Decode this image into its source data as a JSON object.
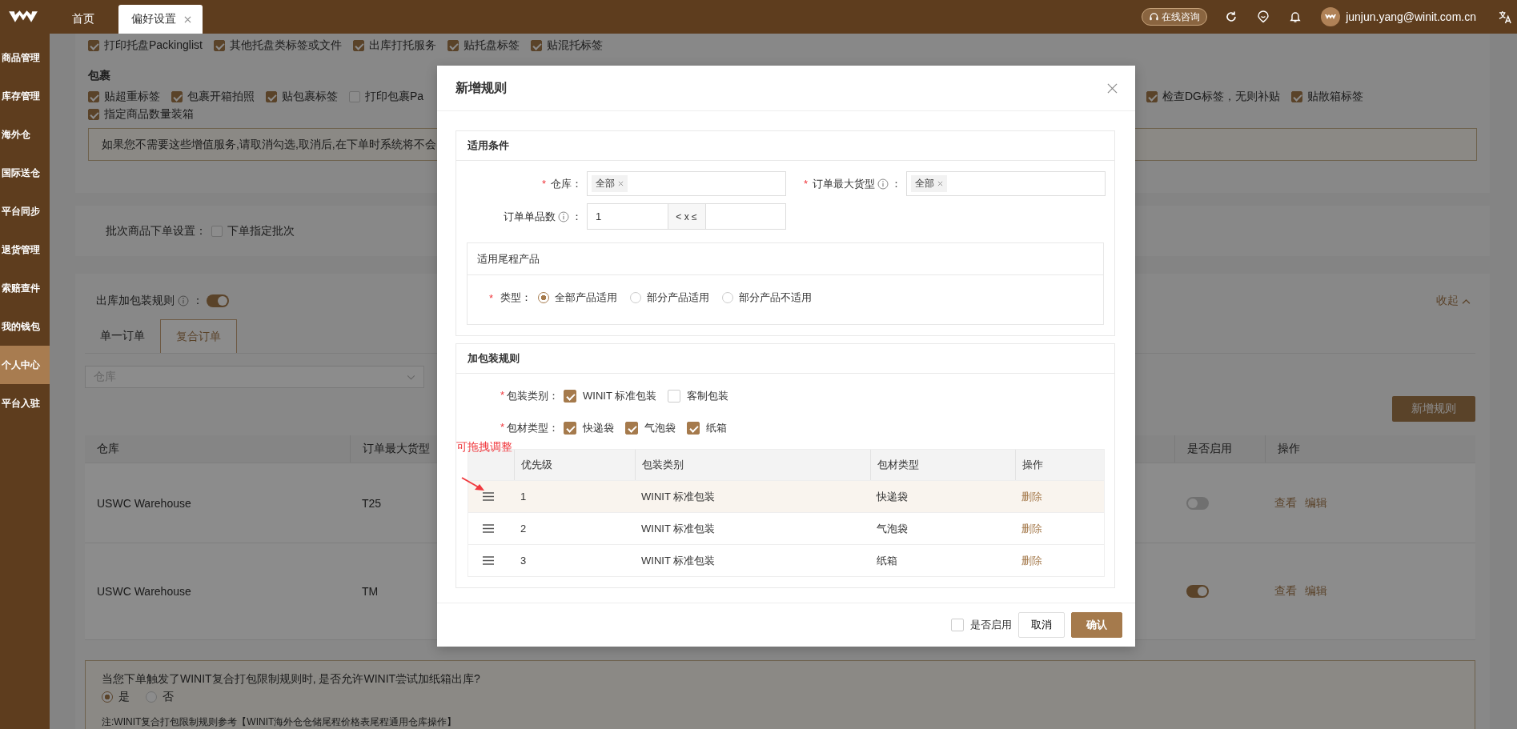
{
  "top_bar": {
    "tabs": [
      {
        "label": "首页",
        "selected": false
      },
      {
        "label": "偏好设置",
        "selected": true
      }
    ],
    "consult_button": "在线咨询",
    "user_email": "junjun.yang@winit.com.cn"
  },
  "sidebar": {
    "items": [
      {
        "label": "商品管理",
        "selected": false
      },
      {
        "label": "库存管理",
        "selected": false
      },
      {
        "label": "海外仓",
        "selected": false
      },
      {
        "label": "国际送仓",
        "selected": false
      },
      {
        "label": "平台同步",
        "selected": false
      },
      {
        "label": "退货管理",
        "selected": false
      },
      {
        "label": "索赔查件",
        "selected": false
      },
      {
        "label": "我的钱包",
        "selected": false
      },
      {
        "label": "个人中心",
        "selected": true
      },
      {
        "label": "平台入驻",
        "selected": false
      }
    ]
  },
  "pallet_services": [
    {
      "label": "打印托盘Packinglist",
      "checked": true
    },
    {
      "label": "其他托盘类标签或文件",
      "checked": true
    },
    {
      "label": "出库打托服务",
      "checked": true
    },
    {
      "label": "贴托盘标签",
      "checked": true
    },
    {
      "label": "贴混托标签",
      "checked": true
    }
  ],
  "parcel": {
    "title": "包裹",
    "services_line_1": [
      {
        "label": "贴超重标签",
        "checked": true
      },
      {
        "label": "包裹开箱拍照",
        "checked": true
      },
      {
        "label": "贴包裹标签",
        "checked": true
      },
      {
        "label": "打印包裹Pa",
        "checked": false
      }
    ],
    "services_line_2": [
      {
        "label": "指定商品数量装箱",
        "checked": true
      }
    ],
    "services_right": [
      {
        "label": "检查DG标签，无则补贴",
        "checked": true
      },
      {
        "label": "贴散箱标签",
        "checked": true
      }
    ]
  },
  "notice": "如果您不需要这些增值服务,请取消勾选,取消后,在下单时系统将不会",
  "batch_setting": {
    "label": "批次商品下单设置：",
    "option": {
      "label": "下单指定批次",
      "checked": false
    }
  },
  "packing_rules": {
    "label": "出库加包装规则",
    "suffix": "：",
    "on": true,
    "collapse": "收起",
    "tabs": [
      {
        "label": "单一订单",
        "selected": false
      },
      {
        "label": "复合订单",
        "selected": true
      }
    ],
    "warehouse_filter": {
      "placeholder": "仓库"
    },
    "add_button": "新增规则",
    "table": {
      "columns": [
        "仓库",
        "订单最大货型",
        "是否启用",
        "操作"
      ],
      "rows": [
        {
          "warehouse": "USWC Warehouse",
          "max_size": "T25",
          "on": false,
          "actions": [
            "查看",
            "编辑"
          ]
        },
        {
          "warehouse": "USWC Warehouse",
          "max_size": "TM",
          "on": true,
          "actions": [
            "查看",
            "编辑"
          ]
        }
      ]
    }
  },
  "bottom_notice": {
    "question": "当您下单触发了WINIT复合打包限制规则时, 是否允许WINIT尝试加纸箱出库?",
    "options": [
      {
        "label": "是",
        "selected": true
      },
      {
        "label": "否",
        "selected": false
      }
    ],
    "note": "注:WINIT复合打包限制规则参考【WINIT海外仓仓储尾程价格表尾程通用仓库操作】"
  },
  "modal": {
    "title": "新增规则",
    "conditions": {
      "title": "适用条件",
      "warehouse": {
        "required_mark": "*",
        "label": "仓库：",
        "tags": [
          "全部"
        ]
      },
      "max_size": {
        "required_mark": "*",
        "label": "订单最大货型",
        "suffix": "：",
        "tags": [
          "全部"
        ]
      },
      "item_count": {
        "label": "订单单品数",
        "suffix": "：",
        "min": "1",
        "operator": "< x ≤"
      },
      "tail_products": {
        "title": "适用尾程产品",
        "required_mark": "*",
        "type_label": "类型：",
        "options": [
          {
            "label": "全部产品适用",
            "selected": true
          },
          {
            "label": "部分产品适用",
            "selected": false
          },
          {
            "label": "部分产品不适用",
            "selected": false
          }
        ]
      }
    },
    "packing": {
      "title": "加包装规则",
      "groups": [
        {
          "required_mark": "*",
          "label": "包装类别：",
          "options": [
            {
              "label": "WINIT 标准包装",
              "checked": true
            },
            {
              "label": "客制包装",
              "checked": false
            }
          ]
        },
        {
          "required_mark": "*",
          "label": "包材类型：",
          "options": [
            {
              "label": "快递袋",
              "checked": true
            },
            {
              "label": "气泡袋",
              "checked": true
            },
            {
              "label": "纸箱",
              "checked": true
            }
          ]
        }
      ],
      "annotation": "可拖拽调整",
      "table": {
        "columns": [
          "优先级",
          "包装类别",
          "包材类型",
          "操作"
        ],
        "rows": [
          {
            "priority": "1",
            "package": "WINIT 标准包装",
            "material": "快递袋",
            "action": "删除",
            "highlighted": true
          },
          {
            "priority": "2",
            "package": "WINIT 标准包装",
            "material": "气泡袋",
            "action": "删除",
            "highlighted": false
          },
          {
            "priority": "3",
            "package": "WINIT 标准包装",
            "material": "纸箱",
            "action": "删除",
            "highlighted": false
          }
        ]
      }
    },
    "footer": {
      "enable": {
        "label": "是否启用",
        "checked": false
      },
      "cancel": "取消",
      "confirm": "确认"
    }
  }
}
